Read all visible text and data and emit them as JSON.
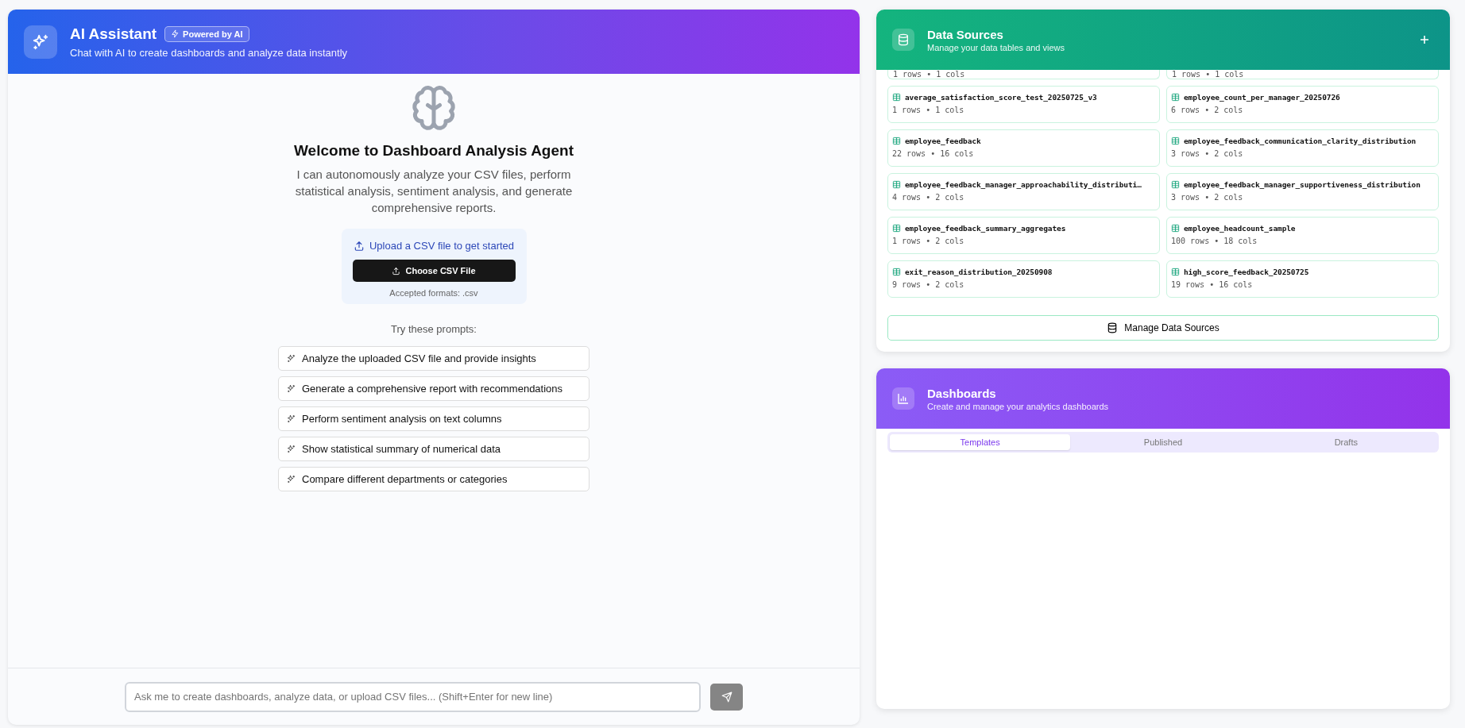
{
  "assistant": {
    "title": "AI Assistant",
    "badge": "Powered by AI",
    "subtitle": "Chat with AI to create dashboards and analyze data instantly",
    "welcome": {
      "title": "Welcome to Dashboard Analysis Agent",
      "description": "I can autonomously analyze your CSV files, perform statistical analysis, sentiment analysis, and generate comprehensive reports.",
      "upload_prompt": "Upload a CSV file to get started",
      "upload_button": "Choose CSV File",
      "formats": "Accepted formats: .csv",
      "prompts_heading": "Try these prompts:",
      "prompts": [
        "Analyze the uploaded CSV file and provide insights",
        "Generate a comprehensive report with recommendations",
        "Perform sentiment analysis on text columns",
        "Show statistical summary of numerical data",
        "Compare different departments or categories"
      ]
    },
    "input": {
      "placeholder": "Ask me to create dashboards, analyze data, or upload CSV files... (Shift+Enter for new line)"
    },
    "send_button": {
      "disabled": true
    }
  },
  "data_sources": {
    "title": "Data Sources",
    "subtitle": "Manage your data tables and views",
    "tables": [
      {
        "meta": "1 rows • 1 cols"
      },
      {
        "meta": "1 rows • 1 cols"
      },
      {
        "name": "average_satisfaction_score_test_20250725_v3",
        "meta": "1 rows • 1 cols"
      },
      {
        "name": "employee_count_per_manager_20250726",
        "meta": "6 rows • 2 cols"
      },
      {
        "name": "employee_feedback",
        "meta": "22 rows • 16 cols"
      },
      {
        "name": "employee_feedback_communication_clarity_distribution",
        "meta": "3 rows • 2 cols"
      },
      {
        "name": "employee_feedback_manager_approachability_distributi…",
        "meta": "4 rows • 2 cols"
      },
      {
        "name": "employee_feedback_manager_supportiveness_distribution",
        "meta": "3 rows • 2 cols"
      },
      {
        "name": "employee_feedback_summary_aggregates",
        "meta": "1 rows • 2 cols"
      },
      {
        "name": "employee_headcount_sample",
        "meta": "100 rows • 18 cols"
      },
      {
        "name": "exit_reason_distribution_20250908",
        "meta": "9 rows • 2 cols"
      },
      {
        "name": "high_score_feedback_20250725",
        "meta": "19 rows • 16 cols"
      }
    ],
    "manage_button": "Manage Data Sources"
  },
  "dashboards": {
    "title": "Dashboards",
    "subtitle": "Create and manage your analytics dashboards",
    "tabs": [
      {
        "label": "Templates",
        "selected": true
      },
      {
        "label": "Published",
        "selected": false
      },
      {
        "label": "Drafts",
        "selected": false
      }
    ]
  }
}
